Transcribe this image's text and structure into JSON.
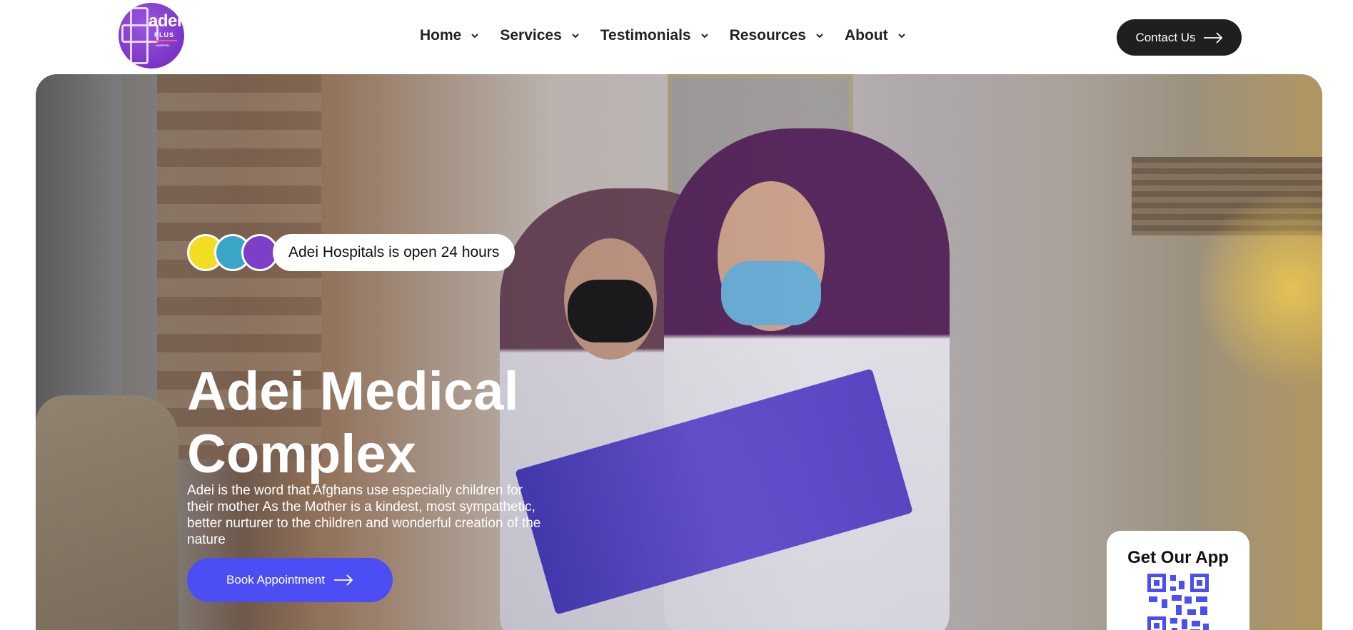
{
  "header": {
    "logo": {
      "word": "adei",
      "sub": "PLUS",
      "tiny": "HOSPITAL"
    },
    "nav": [
      {
        "label": "Home"
      },
      {
        "label": "Services"
      },
      {
        "label": "Testimonials"
      },
      {
        "label": "Resources"
      },
      {
        "label": "About"
      }
    ],
    "contact_label": "Contact Us"
  },
  "hero": {
    "badge_text": "Adei Hospitals is open 24 hours",
    "title": "Adei Medical Complex",
    "description": "Adei is the word that Afghans use especially children for their mother As the Mother is a kindest, most sympathetic, better nurturer to the children and wonderful creation of the nature",
    "book_label": "Book Appointment"
  },
  "app_card": {
    "title": "Get Our App"
  },
  "colors": {
    "brand_purple": "#7a35c6",
    "cta_blue": "#4b4ef2",
    "dark_button": "#1f1f1f"
  },
  "icons": [
    "chevron-down-icon",
    "arrow-right-icon",
    "qr-code-icon"
  ]
}
